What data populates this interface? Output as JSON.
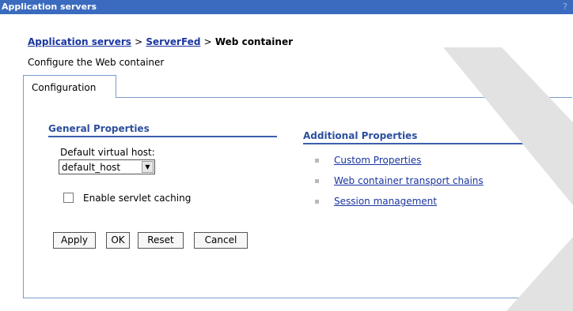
{
  "window": {
    "title": "Application servers",
    "help": "?"
  },
  "breadcrumb": {
    "items": [
      "Application servers",
      "ServerFed"
    ],
    "current": "Web container",
    "separator": ">"
  },
  "page": {
    "description": "Configure the Web container"
  },
  "tabs": [
    {
      "label": "Configuration"
    }
  ],
  "general_properties": {
    "heading": "General Properties",
    "virtual_host_label": "Default virtual host:",
    "virtual_host_value": "default_host",
    "servlet_caching_label": "Enable servlet caching",
    "servlet_caching_checked": false
  },
  "buttons": {
    "apply": "Apply",
    "ok": "OK",
    "reset": "Reset",
    "cancel": "Cancel"
  },
  "additional_properties": {
    "heading": "Additional Properties",
    "links": [
      "Custom Properties",
      "Web container transport chains",
      "Session management"
    ]
  },
  "colors": {
    "titlebar": "#3a6bbf",
    "link": "#1a35a0",
    "border": "#7c9acd"
  }
}
